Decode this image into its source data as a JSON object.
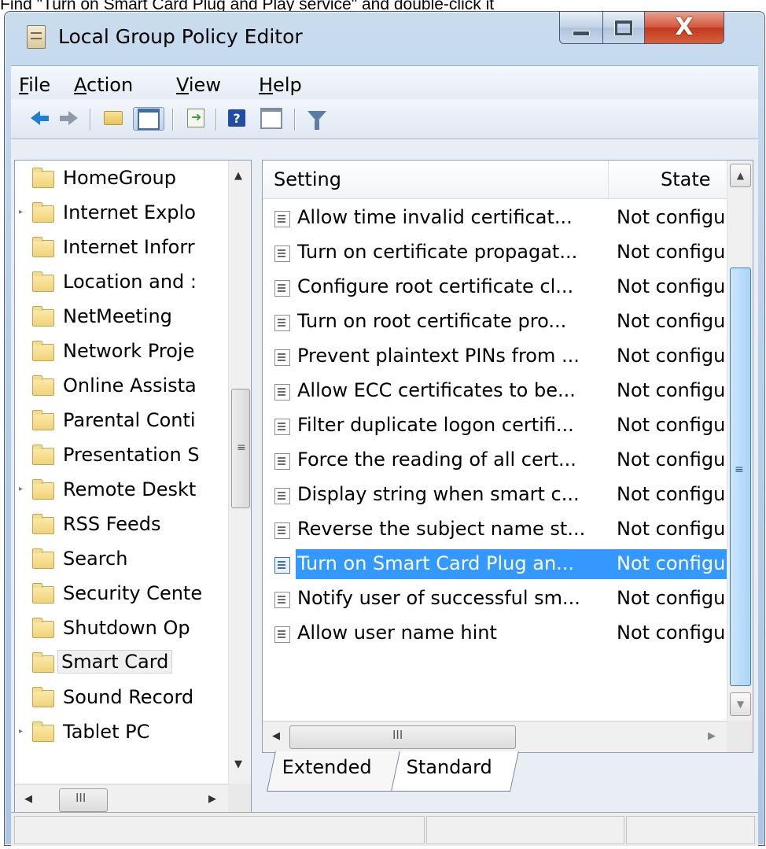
{
  "caption": "Find \"Turn on Smart Card Plug and Play service\" and double-click it",
  "window": {
    "title": "Local Group Policy Editor",
    "controls": {
      "minimize": "minimize",
      "maximize": "maximize",
      "close": "X"
    }
  },
  "menu": {
    "file": {
      "ul": "F",
      "rest": "ile"
    },
    "action": {
      "ul": "A",
      "rest": "ction"
    },
    "view": {
      "ul": "V",
      "rest": "iew"
    },
    "help": {
      "ul": "H",
      "rest": "elp"
    }
  },
  "toolbar": {
    "icons": [
      "back-arrow-icon",
      "forward-arrow-icon",
      "up-folder-icon",
      "show-hide-console-tree-icon",
      "export-list-icon",
      "help-icon",
      "show-action-pane-icon",
      "filter-icon"
    ]
  },
  "tree": {
    "items": [
      {
        "label": "HomeGroup",
        "expandable": false,
        "selected": false
      },
      {
        "label": "Internet Explo",
        "expandable": true,
        "selected": false
      },
      {
        "label": "Internet Inforr",
        "expandable": false,
        "selected": false
      },
      {
        "label": "Location and :",
        "expandable": false,
        "selected": false
      },
      {
        "label": "NetMeeting",
        "expandable": false,
        "selected": false
      },
      {
        "label": "Network Proje",
        "expandable": false,
        "selected": false
      },
      {
        "label": "Online Assista",
        "expandable": false,
        "selected": false
      },
      {
        "label": "Parental Conti",
        "expandable": false,
        "selected": false
      },
      {
        "label": "Presentation S",
        "expandable": false,
        "selected": false
      },
      {
        "label": "Remote Deskt",
        "expandable": true,
        "selected": false
      },
      {
        "label": "RSS Feeds",
        "expandable": false,
        "selected": false
      },
      {
        "label": "Search",
        "expandable": false,
        "selected": false
      },
      {
        "label": "Security Cente",
        "expandable": false,
        "selected": false
      },
      {
        "label": "Shutdown Op",
        "expandable": false,
        "selected": false
      },
      {
        "label": "Smart Card",
        "expandable": false,
        "selected": true
      },
      {
        "label": "Sound Record",
        "expandable": false,
        "selected": false
      },
      {
        "label": "Tablet PC",
        "expandable": true,
        "selected": false
      }
    ]
  },
  "list": {
    "columns": {
      "setting": "Setting",
      "state": "State"
    },
    "rows": [
      {
        "setting": "Allow time invalid certificat...",
        "state": "Not configu",
        "selected": false
      },
      {
        "setting": "Turn on certificate propagat...",
        "state": "Not configu",
        "selected": false
      },
      {
        "setting": "Configure root certificate cl...",
        "state": "Not configu",
        "selected": false
      },
      {
        "setting": "Turn on root certificate pro...",
        "state": "Not configu",
        "selected": false
      },
      {
        "setting": "Prevent plaintext PINs from ...",
        "state": "Not configu",
        "selected": false
      },
      {
        "setting": "Allow ECC certificates to be...",
        "state": "Not configu",
        "selected": false
      },
      {
        "setting": "Filter duplicate logon certifi...",
        "state": "Not configu",
        "selected": false
      },
      {
        "setting": "Force the reading of all cert...",
        "state": "Not configu",
        "selected": false
      },
      {
        "setting": "Display string when smart c...",
        "state": "Not configu",
        "selected": false
      },
      {
        "setting": "Reverse the subject name st...",
        "state": "Not configu",
        "selected": false
      },
      {
        "setting": "Turn on Smart Card Plug an...",
        "state": "Not configu",
        "selected": true
      },
      {
        "setting": "Notify user of successful sm...",
        "state": "Not configu",
        "selected": false
      },
      {
        "setting": "Allow user name hint",
        "state": "Not configu",
        "selected": false
      }
    ]
  },
  "tabs": {
    "extended": "Extended",
    "standard": "Standard",
    "active": "Standard"
  },
  "scrollbar_grip": "III",
  "colors": {
    "selection": "#3399ff",
    "title_gradient": "#b7d0ea",
    "close_button": "#c1381d"
  }
}
